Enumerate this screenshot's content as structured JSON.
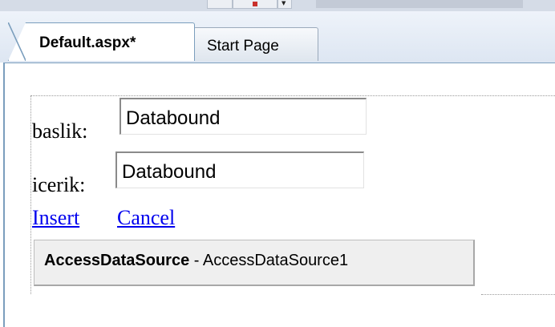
{
  "tabs": [
    {
      "label": "Default.aspx*",
      "active": true
    },
    {
      "label": "Start Page",
      "active": false
    }
  ],
  "form": {
    "fields": [
      {
        "label": "baslik:",
        "value": "Databound"
      },
      {
        "label": "icerik:",
        "value": "Databound"
      }
    ],
    "links": {
      "insert": "Insert",
      "cancel": "Cancel"
    }
  },
  "datasource": {
    "type": "AccessDataSource",
    "separator": " - ",
    "id": "AccessDataSource1"
  },
  "colors": {
    "link": "#0000ee",
    "tab_border": "#7b9ebd"
  }
}
